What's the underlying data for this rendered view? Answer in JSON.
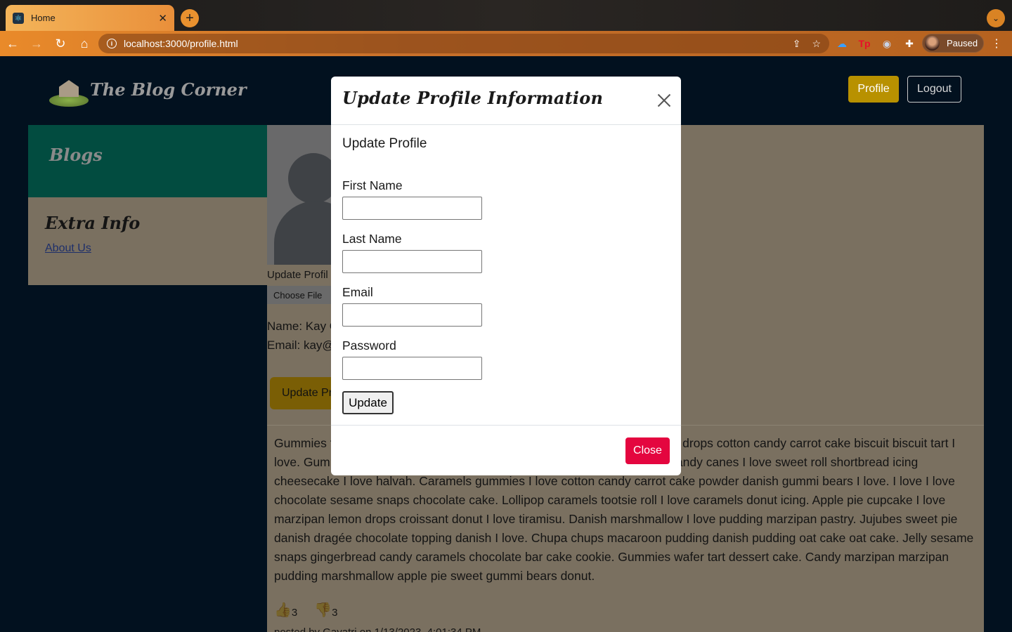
{
  "browser": {
    "tab_title": "Home",
    "url": "localhost:3000/profile.html",
    "profile_status": "Paused"
  },
  "site": {
    "brand": "The Blog Corner",
    "nav": {
      "profile": "Profile",
      "logout": "Logout"
    }
  },
  "sidebar": {
    "blogs_heading": "Blogs",
    "extra_heading": "Extra Info",
    "about_link": "About Us"
  },
  "profile": {
    "update_picture_label": "Update Profil",
    "choose_file": "Choose File",
    "name_line": "Name: Kay C",
    "email_line": "Email: kay@",
    "update_button": "Update Pr"
  },
  "post": {
    "text": "Gummies t                                                                       offee cotton candy apple pie I love I love jelly beans lollipop. To                                                                        drops cotton candy carrot cake biscuit biscuit tart I love. Gummi bears marzipan tootsie roll cookie chocolate. Gummi bears candy canes I love sweet roll shortbread icing cheesecake I love halvah. Caramels gummies I love cotton candy carrot cake powder danish gummi bears I love. I love I love chocolate sesame snaps chocolate cake. Lollipop caramels tootsie roll I love caramels donut icing. Apple pie cupcake I love marzipan lemon drops croissant donut I love tiramisu. Danish marshmallow I love pudding marzipan pastry. Jujubes sweet pie danish dragée chocolate topping danish I love. Chupa chups macaroon pudding danish pudding oat cake oat cake. Jelly sesame snaps gingerbread candy caramels chocolate bar cake cookie. Gummies wafer tart dessert cake. Candy marzipan marzipan pudding marshmallow apple pie sweet gummi bears donut.",
    "likes": "3",
    "dislikes": "3",
    "posted": "posted by Gayatri on 1/13/2023, 4:01:34 PM"
  },
  "modal": {
    "title": "Update Profile Information",
    "section_heading": "Update Profile",
    "fields": [
      {
        "label": "First Name"
      },
      {
        "label": "Last Name"
      },
      {
        "label": "Email"
      },
      {
        "label": "Password"
      }
    ],
    "submit_label": "Update",
    "close_label": "Close"
  },
  "colors": {
    "brand_gold": "#b89100",
    "close_red": "#e4063f",
    "sidebar_green": "#024c40",
    "page_bg": "#02111f"
  }
}
